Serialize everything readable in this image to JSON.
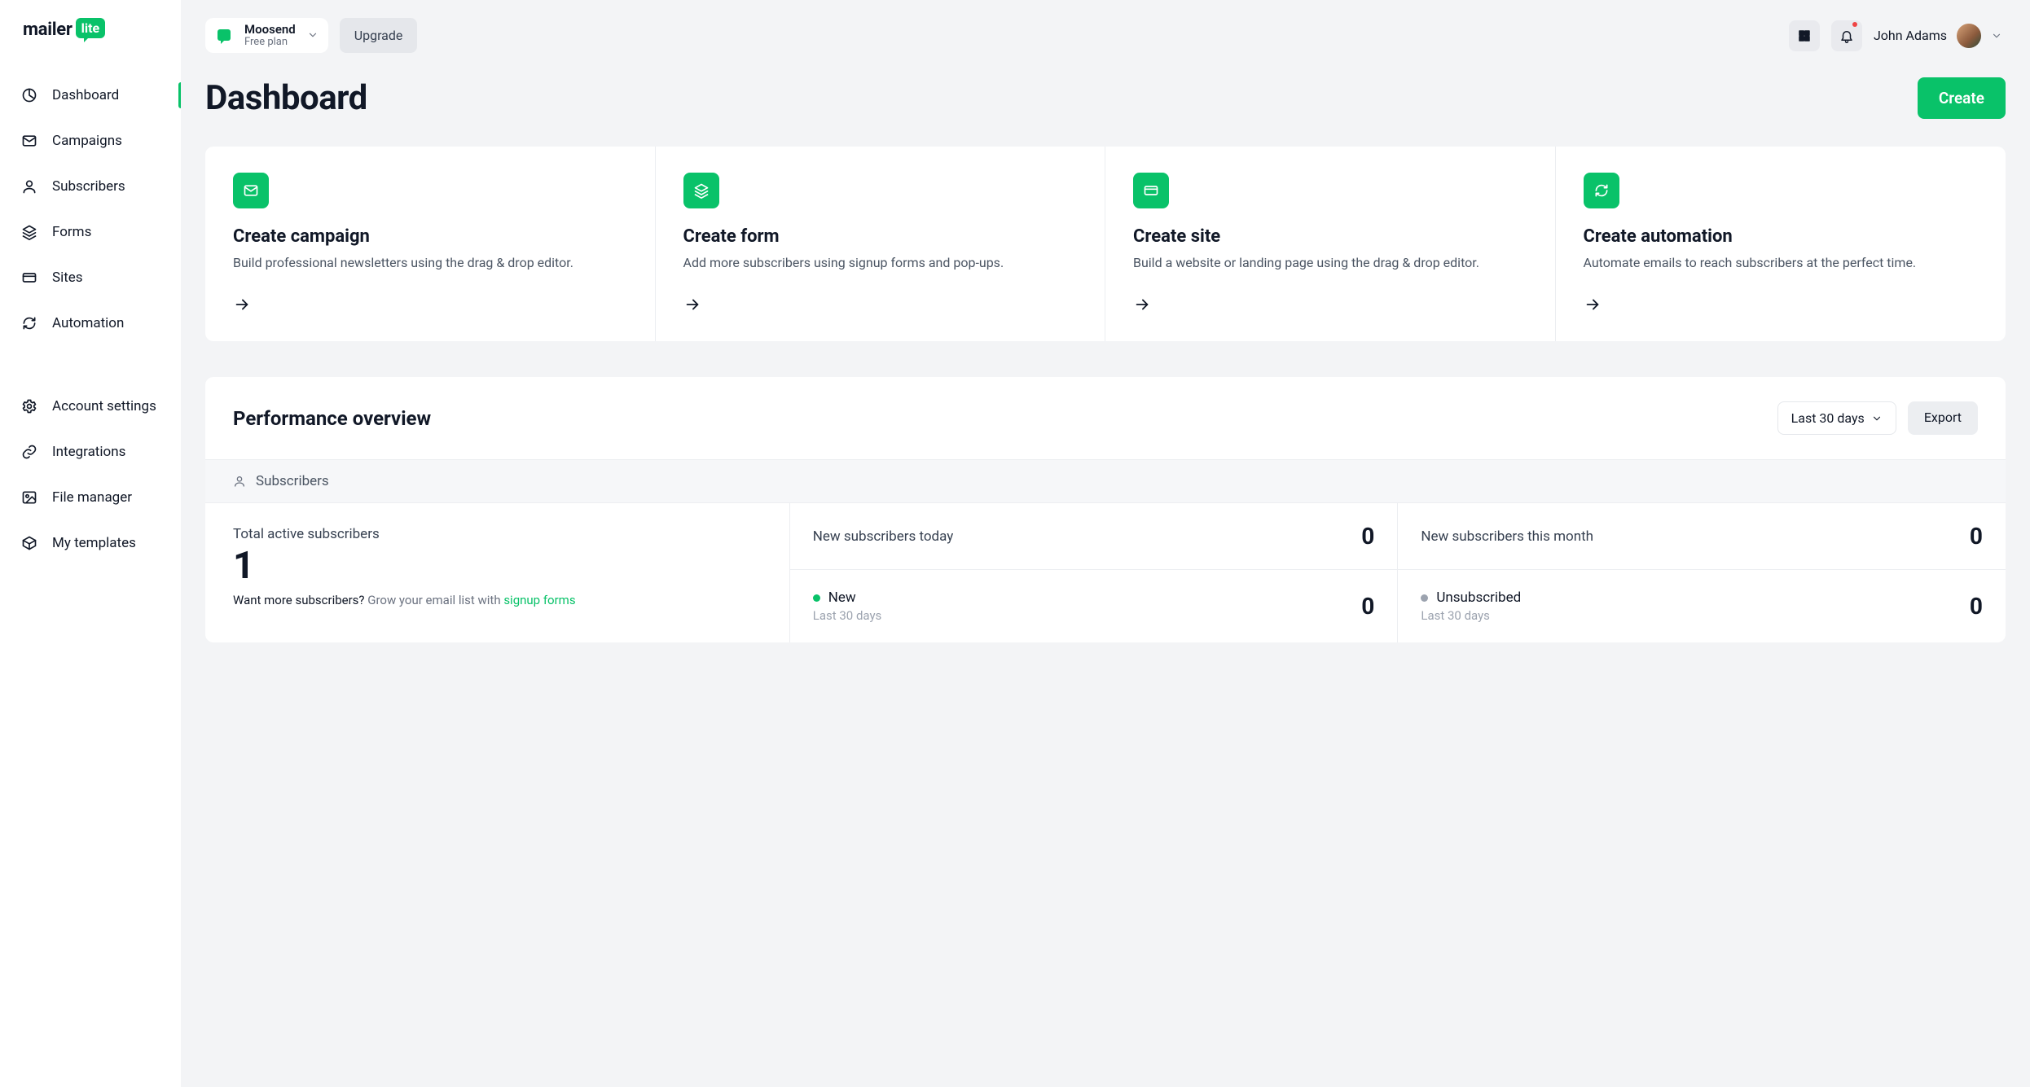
{
  "brand": {
    "text": "mailer",
    "badge": "lite"
  },
  "sidebar": {
    "main": [
      {
        "label": "Dashboard",
        "icon": "pie"
      },
      {
        "label": "Campaigns",
        "icon": "mail"
      },
      {
        "label": "Subscribers",
        "icon": "user"
      },
      {
        "label": "Forms",
        "icon": "layers"
      },
      {
        "label": "Sites",
        "icon": "card"
      },
      {
        "label": "Automation",
        "icon": "refresh"
      }
    ],
    "secondary": [
      {
        "label": "Account settings",
        "icon": "gear"
      },
      {
        "label": "Integrations",
        "icon": "link"
      },
      {
        "label": "File manager",
        "icon": "image"
      },
      {
        "label": "My templates",
        "icon": "package"
      }
    ]
  },
  "header": {
    "account_name": "Moosend",
    "account_plan": "Free plan",
    "upgrade_label": "Upgrade",
    "user_name": "John Adams"
  },
  "page": {
    "title": "Dashboard",
    "create_label": "Create"
  },
  "quick": [
    {
      "title": "Create campaign",
      "desc": "Build professional newsletters using the drag & drop editor.",
      "icon": "mail"
    },
    {
      "title": "Create form",
      "desc": "Add more subscribers using signup forms and pop-ups.",
      "icon": "layers"
    },
    {
      "title": "Create site",
      "desc": "Build a website or landing page using the drag & drop editor.",
      "icon": "card"
    },
    {
      "title": "Create automation",
      "desc": "Automate emails to reach subscribers at the perfect time.",
      "icon": "refresh"
    }
  ],
  "perf": {
    "title": "Performance overview",
    "range_label": "Last 30 days",
    "export_label": "Export",
    "tab_label": "Subscribers",
    "total_label": "Total active subscribers",
    "total_value": "1",
    "hint_pre": "Want more subscribers? ",
    "hint_mid": "Grow your email list with ",
    "hint_link": "signup forms",
    "cells": {
      "today_label": "New subscribers today",
      "today_val": "0",
      "month_label": "New subscribers this month",
      "month_val": "0",
      "new_label": "New",
      "new_sub": "Last 30 days",
      "new_val": "0",
      "unsub_label": "Unsubscribed",
      "unsub_sub": "Last 30 days",
      "unsub_val": "0"
    }
  }
}
